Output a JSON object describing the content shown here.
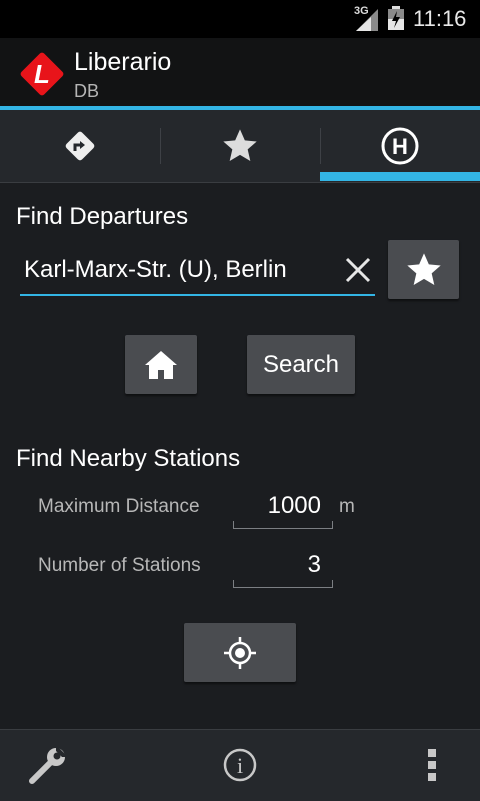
{
  "status_bar": {
    "network_type": "3G",
    "time": "11:16",
    "icons": [
      "signal-icon",
      "battery-icon"
    ]
  },
  "action_bar": {
    "logo_letter": "L",
    "title": "Liberario",
    "subtitle": "DB",
    "accent_color": "#33b5e5",
    "logo_color": "#e8141a"
  },
  "tabs": [
    {
      "icon": "directions-icon",
      "selected": false
    },
    {
      "icon": "star-icon",
      "selected": false
    },
    {
      "icon": "bus-stop-icon",
      "selected": true,
      "glyph": "H"
    }
  ],
  "departures": {
    "heading": "Find Departures",
    "station_value": "Karl-Marx-Str. (U), Berlin",
    "search_label": "Search"
  },
  "nearby": {
    "heading": "Find Nearby Stations",
    "max_distance_label": "Maximum Distance",
    "max_distance_value": "1000",
    "max_distance_unit": "m",
    "num_stations_label": "Number of Stations",
    "num_stations_value": "3"
  },
  "bottom_bar": {
    "icons": [
      "wrench-icon",
      "info-icon",
      "overflow-menu-icon"
    ],
    "info_glyph": "i"
  }
}
